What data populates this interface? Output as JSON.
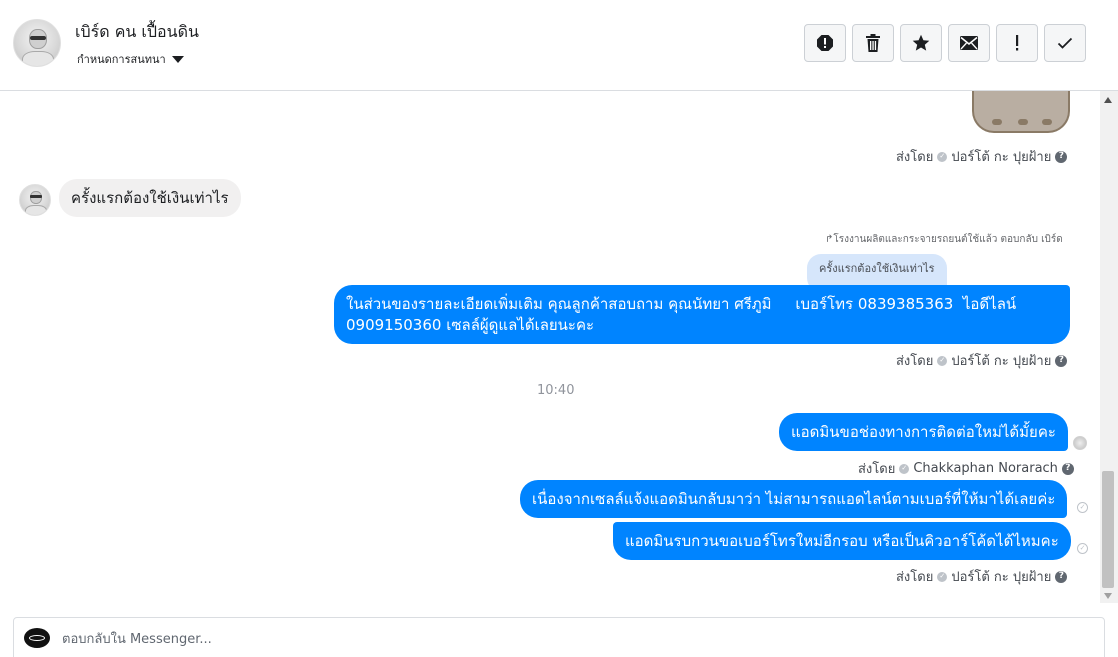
{
  "header": {
    "contact_name": "เบิร์ด คน เปื้อนดิน",
    "conversation_settings_label": "กำหนดการสนทนา",
    "toolbar_icons": [
      "report-spam-icon",
      "trash-icon",
      "star-icon",
      "envelope-icon",
      "exclamation-icon",
      "checkmark-icon"
    ]
  },
  "messages": {
    "sent_by_1": {
      "label": "ส่งโดย",
      "name": "ปอร์โต้ กะ ปุยฝ้าย"
    },
    "incoming_1": "ครั้งแรกต้องใช้เงินเท่าไร",
    "reply_meta": "โรงงานผลิตและกระจายรถยนต์ใช้แล้ว ตอบกลับ เบิร์ด",
    "quoted_text": "ครั้งแรกต้องใช้เงินเท่าไร",
    "outgoing_1_line1": "ในส่วนของรายละเอียดเพิ่มเติม คุณลูกค้าสอบถาม คุณนัทยา ศรีภูมิ     เบอร์โทร 0839385363  ไอดีไลน์",
    "outgoing_1_line2": "0909150360 เซลล์ผู้ดูแลได้เลยนะคะ",
    "sent_by_2": {
      "label": "ส่งโดย",
      "name": "ปอร์โต้ กะ ปุยฝ้าย"
    },
    "timestamp": "10:40",
    "outgoing_2": "แอดมินขอช่องทางการติดต่อใหม่ได้มั้ยคะ",
    "sent_by_3": {
      "label": "ส่งโดย",
      "name": "Chakkaphan Norarach"
    },
    "outgoing_3": "เนื่องจากเซลล์แจ้งแอดมินกลับมาว่า ไม่สามารถแอดไลน์ตามเบอร์ที่ให้มาได้เลยค่ะ",
    "outgoing_4": "แอดมินรบกวนขอเบอร์โทรใหม่อีกรอบ หรือเป็นคิวอาร์โค้ดได้ไหมคะ",
    "sent_by_4": {
      "label": "ส่งโดย",
      "name": "ปอร์โต้ กะ ปุยฝ้าย"
    }
  },
  "composer": {
    "placeholder": "ตอบกลับใน Messenger..."
  },
  "colors": {
    "outgoing_bubble": "#0084ff",
    "incoming_bubble": "#f1f0f0",
    "quoted_bubble": "#d6e6fb"
  }
}
